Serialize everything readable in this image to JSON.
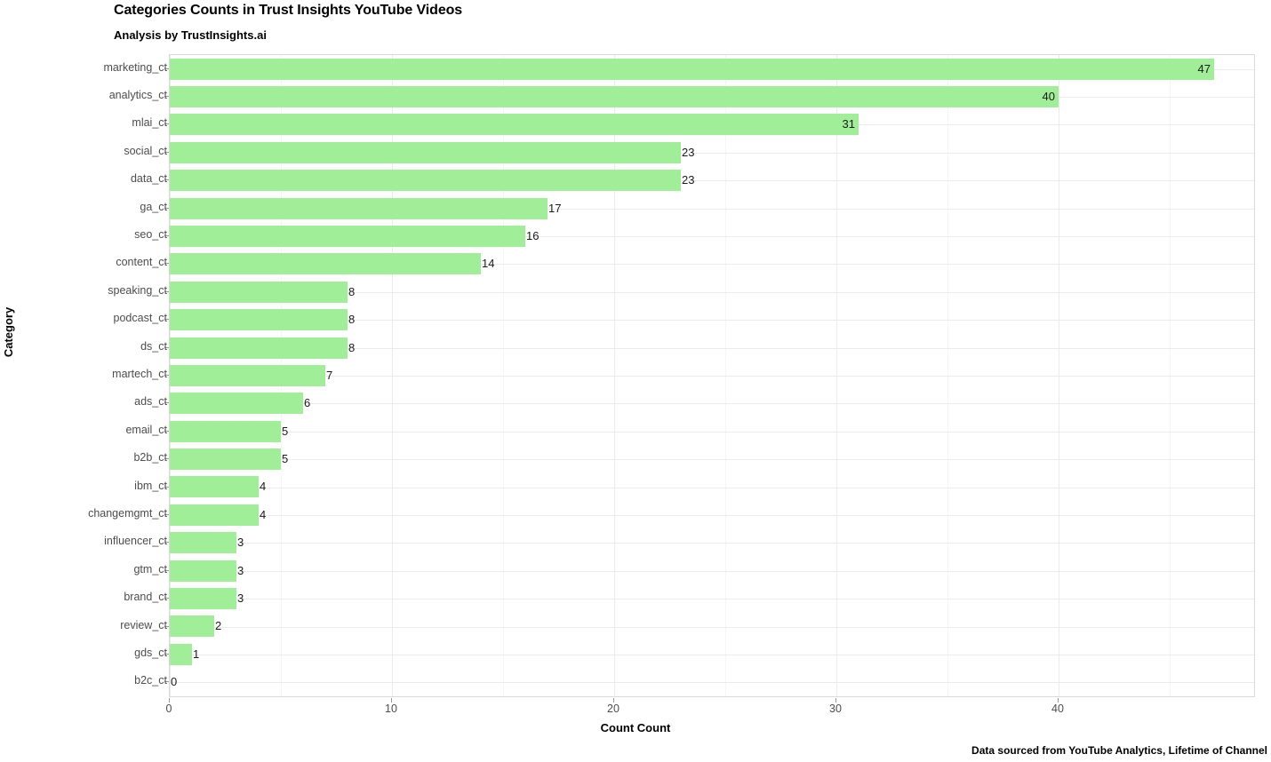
{
  "chart_data": {
    "type": "bar",
    "orientation": "horizontal",
    "title": "Categories Counts in Trust Insights YouTube Videos",
    "subtitle": "Analysis by TrustInsights.ai",
    "caption": "Data sourced from YouTube Analytics, Lifetime of Channel",
    "xlabel": "Count Count",
    "ylabel": "Category",
    "xlim": [
      0,
      48.8
    ],
    "x_ticks": [
      0,
      10,
      20,
      30,
      40
    ],
    "x_tick_labels": [
      "0",
      "10",
      "20",
      "30",
      "40"
    ],
    "grid": true,
    "legend": false,
    "bar_color": "#a1ee99",
    "categories": [
      "marketing_ct",
      "analytics_ct",
      "mlai_ct",
      "social_ct",
      "data_ct",
      "ga_ct",
      "seo_ct",
      "content_ct",
      "speaking_ct",
      "podcast_ct",
      "ds_ct",
      "martech_ct",
      "ads_ct",
      "email_ct",
      "b2b_ct",
      "ibm_ct",
      "changemgmt_ct",
      "influencer_ct",
      "gtm_ct",
      "brand_ct",
      "review_ct",
      "gds_ct",
      "b2c_ct"
    ],
    "values": [
      47,
      40,
      31,
      23,
      23,
      17,
      16,
      14,
      8,
      8,
      8,
      7,
      6,
      5,
      5,
      4,
      4,
      3,
      3,
      3,
      2,
      1,
      0
    ],
    "value_labels": [
      "47",
      "40",
      "31",
      "23",
      "23",
      "17",
      "16",
      "14",
      "8",
      "8",
      "8",
      "7",
      "6",
      "5",
      "5",
      "4",
      "4",
      "3",
      "3",
      "3",
      "2",
      "1",
      "0"
    ]
  },
  "colors": {
    "bar": "#a1ee99",
    "grid_major": "#ebebeb",
    "grid_minor": "#f5f5f5",
    "panel_border": "#d9d9d9",
    "tick_text": "#4d4d4d",
    "title_text": "#000000"
  }
}
